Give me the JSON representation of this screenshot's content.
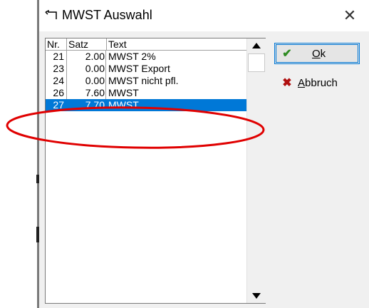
{
  "window": {
    "title": "MWST Auswahl",
    "close_glyph": "✕"
  },
  "list": {
    "columns": [
      "Nr.",
      "Satz",
      "Text"
    ],
    "rows": [
      {
        "nr": "21",
        "satz": "2.00",
        "text": "MWST 2%"
      },
      {
        "nr": "23",
        "satz": "0.00",
        "text": "MWST Export"
      },
      {
        "nr": "24",
        "satz": "0.00",
        "text": "MWST nicht pfl."
      },
      {
        "nr": "26",
        "satz": "7.60",
        "text": "MWST"
      },
      {
        "nr": "27",
        "satz": "7.70",
        "text": "MWST",
        "selected": true
      }
    ]
  },
  "buttons": {
    "ok": {
      "label_first": "O",
      "label_rest": "k",
      "icon": "check-icon"
    },
    "abbruch": {
      "label_first": "A",
      "label_rest": "bbruch",
      "icon": "cross-icon"
    }
  },
  "colors": {
    "selection": "#0078d7",
    "annotation": "#e00000",
    "ok_icon": "#2e8b22",
    "cancel_icon": "#b01010"
  }
}
